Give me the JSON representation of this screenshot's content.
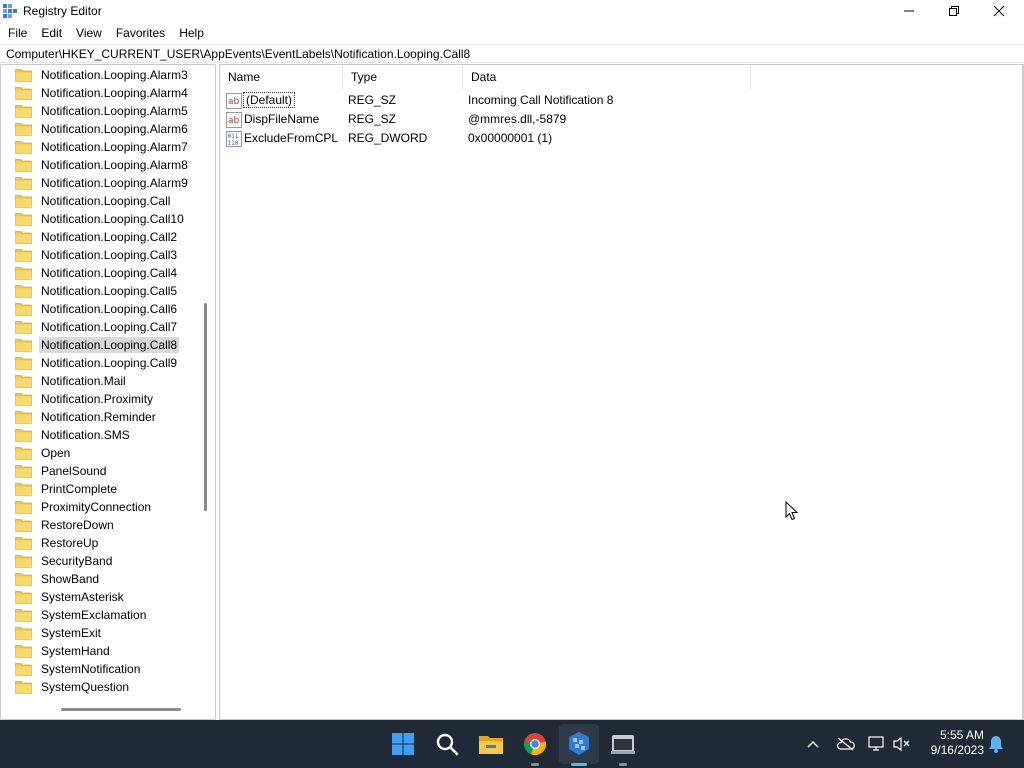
{
  "window": {
    "title": "Registry Editor",
    "minimize_glyph": "—",
    "maximize_glyph": "❐",
    "close_glyph": "✕"
  },
  "menu": [
    "File",
    "Edit",
    "View",
    "Favorites",
    "Help"
  ],
  "address": "Computer\\HKEY_CURRENT_USER\\AppEvents\\EventLabels\\Notification.Looping.Call8",
  "tree": {
    "selected": "Notification.Looping.Call8",
    "items": [
      "Notification.Looping.Alarm3",
      "Notification.Looping.Alarm4",
      "Notification.Looping.Alarm5",
      "Notification.Looping.Alarm6",
      "Notification.Looping.Alarm7",
      "Notification.Looping.Alarm8",
      "Notification.Looping.Alarm9",
      "Notification.Looping.Call",
      "Notification.Looping.Call10",
      "Notification.Looping.Call2",
      "Notification.Looping.Call3",
      "Notification.Looping.Call4",
      "Notification.Looping.Call5",
      "Notification.Looping.Call6",
      "Notification.Looping.Call7",
      "Notification.Looping.Call8",
      "Notification.Looping.Call9",
      "Notification.Mail",
      "Notification.Proximity",
      "Notification.Reminder",
      "Notification.SMS",
      "Open",
      "PanelSound",
      "PrintComplete",
      "ProximityConnection",
      "RestoreDown",
      "RestoreUp",
      "SecurityBand",
      "ShowBand",
      "SystemAsterisk",
      "SystemExclamation",
      "SystemExit",
      "SystemHand",
      "SystemNotification",
      "SystemQuestion"
    ]
  },
  "list": {
    "columns": {
      "name": "Name",
      "type": "Type",
      "data": "Data"
    },
    "rows": [
      {
        "icon": "string-value-icon",
        "name": "(Default)",
        "type": "REG_SZ",
        "data": "Incoming Call Notification 8"
      },
      {
        "icon": "string-value-icon",
        "name": "DispFileName",
        "type": "REG_SZ",
        "data": "@mmres.dll,-5879"
      },
      {
        "icon": "binary-value-icon",
        "name": "ExcludeFromCPL",
        "type": "REG_DWORD",
        "data": "0x00000001 (1)"
      }
    ]
  },
  "taskbar": {
    "apps": [
      "start-icon",
      "search-icon",
      "file-explorer-icon",
      "chrome-icon",
      "registry-editor-icon",
      "terminal-icon"
    ],
    "tray": [
      "chevron-up-icon",
      "onedrive-icon",
      "network-icon",
      "volume-muted-icon"
    ],
    "time": "5:55 AM",
    "date": "9/16/2023",
    "notification_icon": "bell-icon"
  },
  "colors": {
    "taskbar_bg": "#1f2a36",
    "selection": "#d9d9d9",
    "folder": "#f2c744"
  }
}
